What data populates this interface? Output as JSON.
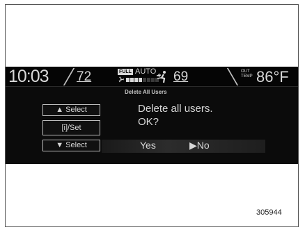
{
  "status_bar": {
    "time": "10:03",
    "driver_temp": "72",
    "fan_mode_badge": "FULL",
    "fan_mode": "AUTO",
    "fan_level_fraction": 0.5,
    "passenger_temp": "69",
    "outside_temp_label": "OUT TEMP",
    "outside_temp": "86°F"
  },
  "screen": {
    "title": "Delete All Users",
    "message_line1": "Delete all users.",
    "message_line2": "OK?",
    "option_yes": "Yes",
    "option_no": "▶No"
  },
  "buttons": {
    "select_up": "▲  Select",
    "set": "[i]/Set",
    "select_down": "▼  Select"
  },
  "figure_id": "305944",
  "icons": [
    "fan-icon",
    "airflow-mode-icon"
  ]
}
